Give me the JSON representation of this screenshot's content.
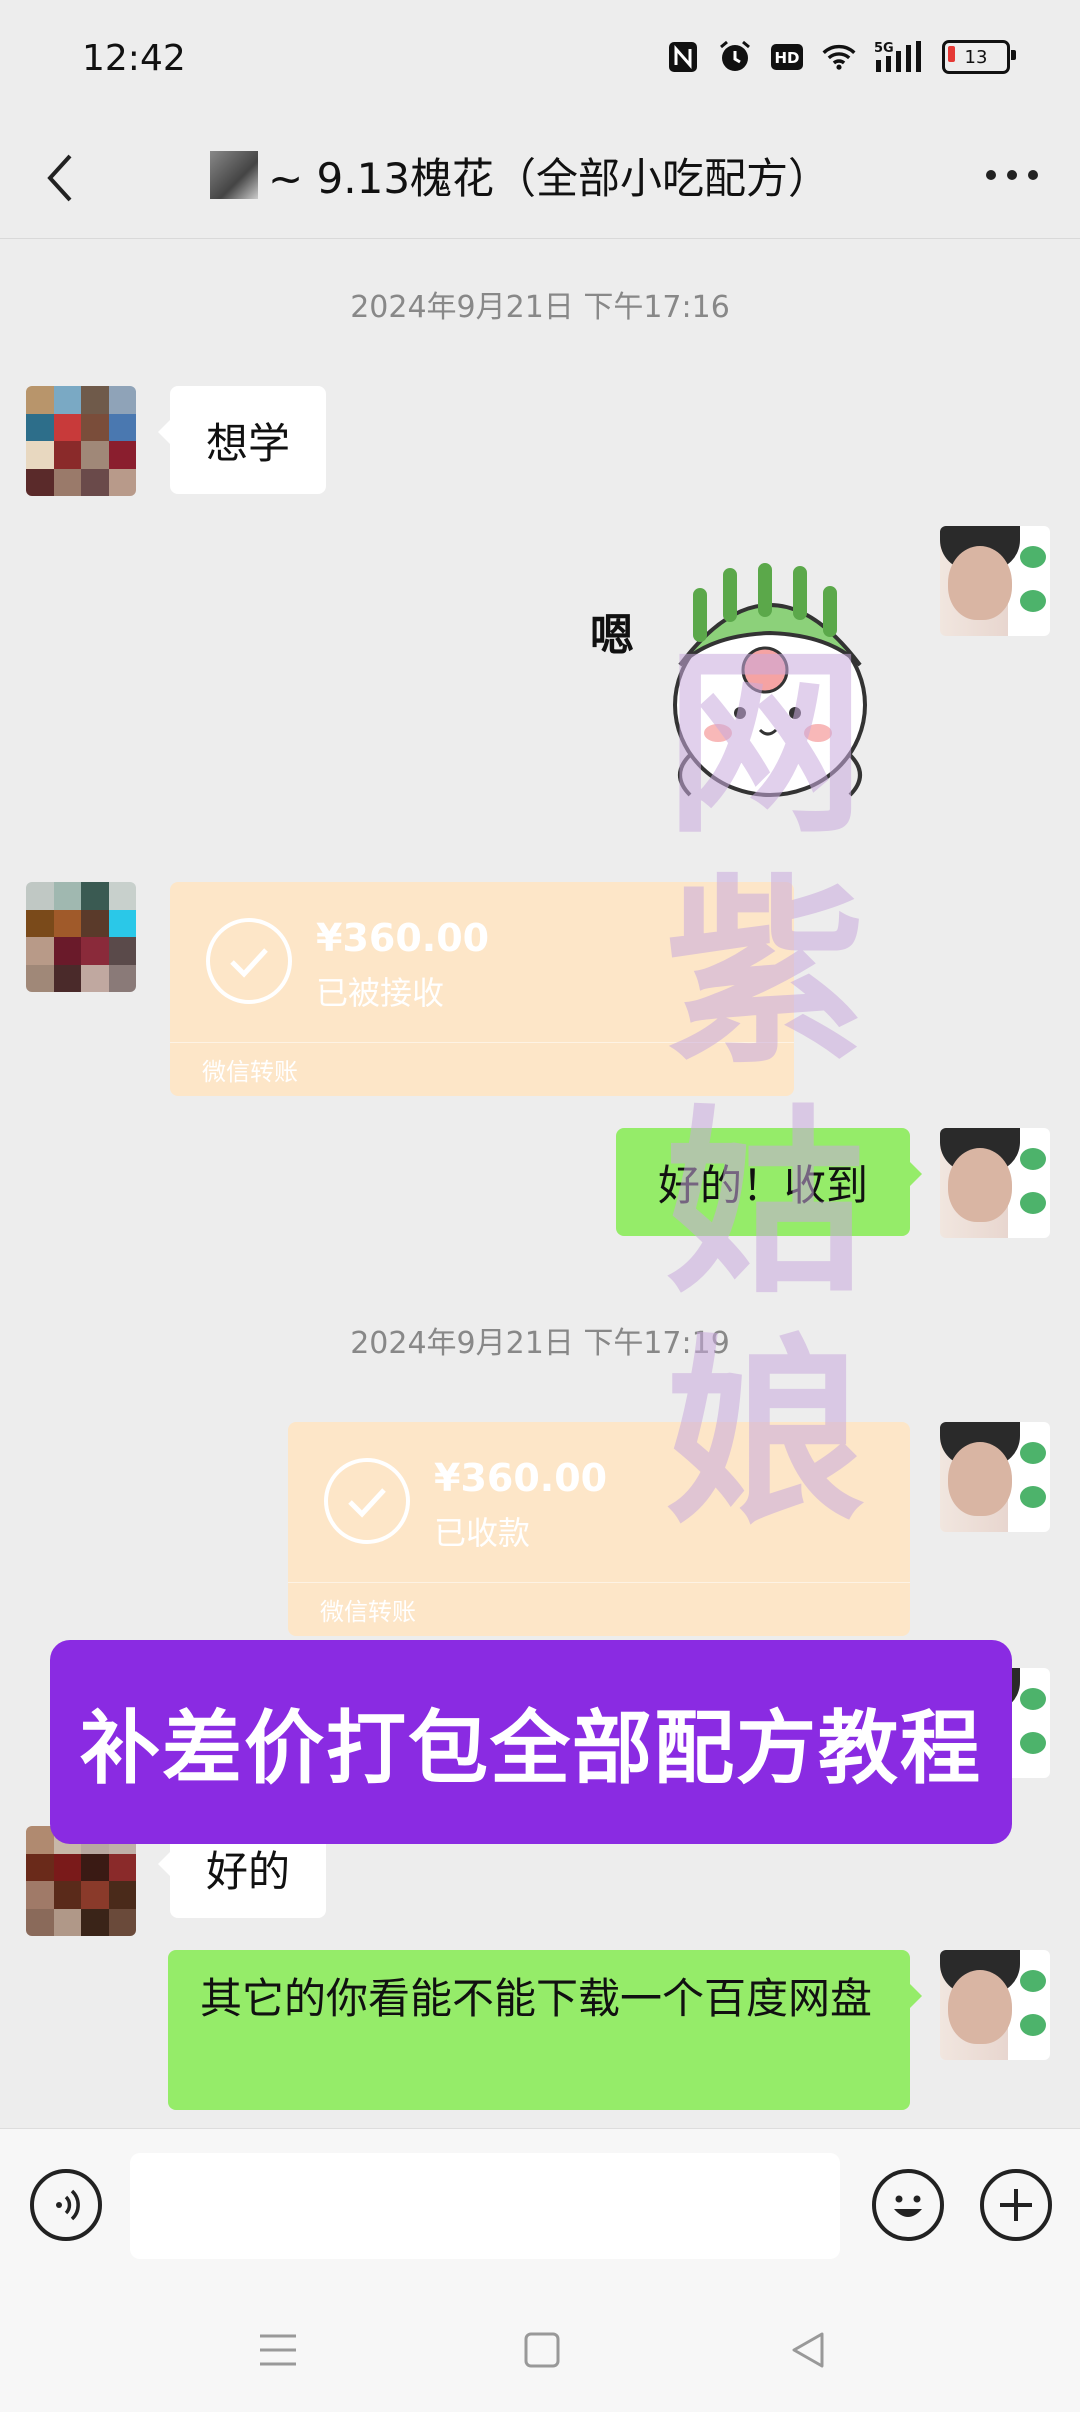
{
  "status_bar": {
    "time": "12:42",
    "battery": "13",
    "network": "5G",
    "icons": [
      "nfc-icon",
      "alarm-icon",
      "hd-icon",
      "wifi-icon",
      "signal-icon",
      "battery-icon"
    ]
  },
  "header": {
    "title": "~ 9.13槐花（全部小吃配方）"
  },
  "timestamps": [
    "2024年9月21日 下午17:16",
    "2024年9月21日 下午17:19"
  ],
  "messages": {
    "m1": "想学",
    "sticker_text": "嗯",
    "transfer1": {
      "amount": "¥360.00",
      "status": "已被接收",
      "label": "微信转账"
    },
    "m3": "好的！收到",
    "transfer2": {
      "amount": "¥360.00",
      "status": "已收款",
      "label": "微信转账"
    },
    "m5": "好的",
    "m6": "其它的你看能不能下载一个百度网盘"
  },
  "overlay": {
    "banner": "补差价打包全部配方教程",
    "watermark": [
      "网",
      "紫",
      "姑",
      "娘"
    ]
  },
  "colors": {
    "bubble_self": "#95ec69",
    "bubble_other": "#ffffff",
    "transfer": "#fde6c8",
    "banner": "#8a2be2",
    "background": "#ededed"
  }
}
